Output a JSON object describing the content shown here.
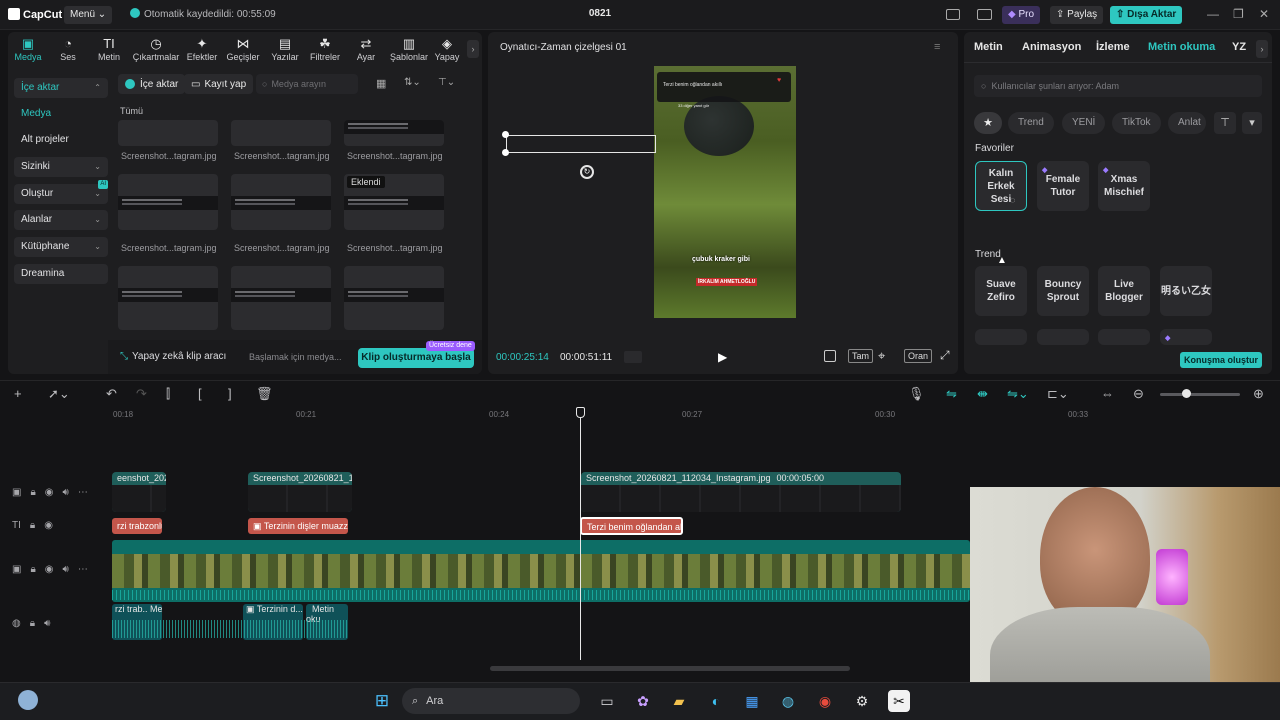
{
  "app": {
    "logo": "CapCut",
    "menu_label": "Menü",
    "autosave_text": "Otomatik kaydedildi: 00:55:09",
    "project_title": "0821",
    "pro_label": "Pro",
    "share_label": "Paylaş",
    "export_label": "Dışa Aktar",
    "accent": "#2ec7c0"
  },
  "toolbar": {
    "items": [
      {
        "label": "Medya",
        "icon": "media-icon"
      },
      {
        "label": "Ses",
        "icon": "audio-icon"
      },
      {
        "label": "Metin",
        "icon": "text-icon"
      },
      {
        "label": "Çıkartmalar",
        "icon": "sticker-icon"
      },
      {
        "label": "Efektler",
        "icon": "effects-icon"
      },
      {
        "label": "Geçişler",
        "icon": "transitions-icon"
      },
      {
        "label": "Yazılar",
        "icon": "captions-icon"
      },
      {
        "label": "Filtreler",
        "icon": "filters-icon"
      },
      {
        "label": "Ayar",
        "icon": "adjust-icon"
      },
      {
        "label": "Şablonlar",
        "icon": "templates-icon"
      },
      {
        "label": "Yapay",
        "icon": "ai-icon"
      }
    ]
  },
  "sidebar": {
    "items": [
      {
        "label": "İçe aktar"
      },
      {
        "label": "Medya"
      },
      {
        "label": "Alt projeler"
      },
      {
        "label": "Sizinki"
      },
      {
        "label": "Oluştur",
        "badge": "AI"
      },
      {
        "label": "Alanlar"
      },
      {
        "label": "Kütüphane"
      },
      {
        "label": "Dreamina"
      }
    ]
  },
  "media": {
    "import_label": "İçe aktar",
    "record_label": "Kayıt yap",
    "search_placeholder": "Medya arayın",
    "filter_all": "Tümü",
    "added_badge": "Eklendi",
    "thumb_label": "Screenshot...tagram.jpg",
    "ai_clip_label": "Yapay zekâ klip aracı",
    "ai_clip_hint": "Başlamak için medya...",
    "create_clip_label": "Klip oluşturmaya başla",
    "free_trial": "Ücretsiz dene"
  },
  "player": {
    "title": "Oynatıcı-Zaman çizelgesi 01",
    "current_time": "00:00:25:14",
    "total_time": "00:00:51:11",
    "full_label": "Tam",
    "ratio_label": "Oran",
    "overlay_text": "çubuk kraker gibi",
    "overlay_text_2": "İRKALIM AHMETLOĞLU",
    "post_line": "Terzi benim oğlandan akıllı",
    "post_views": "33 diğer yanıt gör"
  },
  "right": {
    "tabs": [
      "Metin",
      "Animasyon",
      "İzleme",
      "Metin okuma",
      "YZ"
    ],
    "active_tab": "Metin okuma",
    "search_placeholder": "Kullanıcılar şunları arıyor: Adam",
    "chips": [
      "Trend",
      "YENİ",
      "TikTok",
      "Anlat"
    ],
    "favorites_title": "Favoriler",
    "favorites": [
      "Kalın Erkek Sesi",
      "Female Tutor",
      "Xmas Mischief"
    ],
    "trend_title": "Trend",
    "trend": [
      "Suave Zefiro",
      "Bouncy Sprout",
      "Live Blogger",
      "明るい乙女"
    ],
    "generate_label": "Konuşma oluştur"
  },
  "timeline": {
    "ruler": [
      "00:18",
      "00:21",
      "00:24",
      "00:27",
      "00:30",
      "00:33"
    ],
    "video_clips": [
      {
        "label": "eenshot_20260"
      },
      {
        "label": "Screenshot_20260821_112"
      },
      {
        "label": "Screenshot_20260821_112034_Instagram.jpg",
        "duration": "00:00:05:00"
      }
    ],
    "text_clips": [
      {
        "label": "rzi trabzonlu"
      },
      {
        "label": "Terzinin dişler muazzam"
      },
      {
        "label": "Terzi benim oğlandan akıl"
      }
    ],
    "audio_clips": [
      {
        "label": "rzi trab..."
      },
      {
        "label": "Me"
      },
      {
        "label": "Terzinin d..."
      },
      {
        "label": "Metin oku"
      }
    ]
  },
  "taskbar": {
    "search_label": "Ara"
  }
}
